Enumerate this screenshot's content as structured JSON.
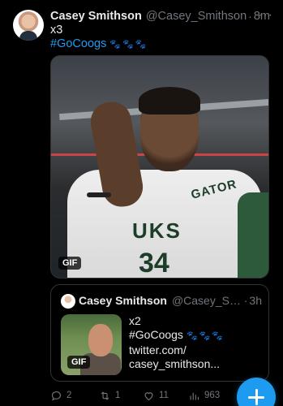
{
  "tweet": {
    "author_name": "Casey Smithson",
    "author_handle": "@Casey_Smithson",
    "separator": "·",
    "time": "8m",
    "more_label": "···",
    "text_line1": "x3",
    "hashtag": "#GoCoogs",
    "paws": "🐾🐾🐾",
    "media_badge": "GIF",
    "media_jersey_text": "UKS",
    "media_towel_text": "GATOR",
    "media_number": "34"
  },
  "quote": {
    "author_name": "Casey Smithson",
    "author_handle": "@Casey_Smit...",
    "separator": "·",
    "time": "3h",
    "line1": "x2",
    "hashtag": "#GoCoogs",
    "paws": "🐾🐾🐾",
    "link_line1": "twitter.com/",
    "link_line2": "casey_smithson...",
    "thumb_badge": "GIF"
  },
  "actions": {
    "replies": "2",
    "retweets": "1",
    "likes": "11",
    "views": "963"
  },
  "fab": {
    "icon": "plus-icon",
    "color": "#1d9bf0"
  }
}
